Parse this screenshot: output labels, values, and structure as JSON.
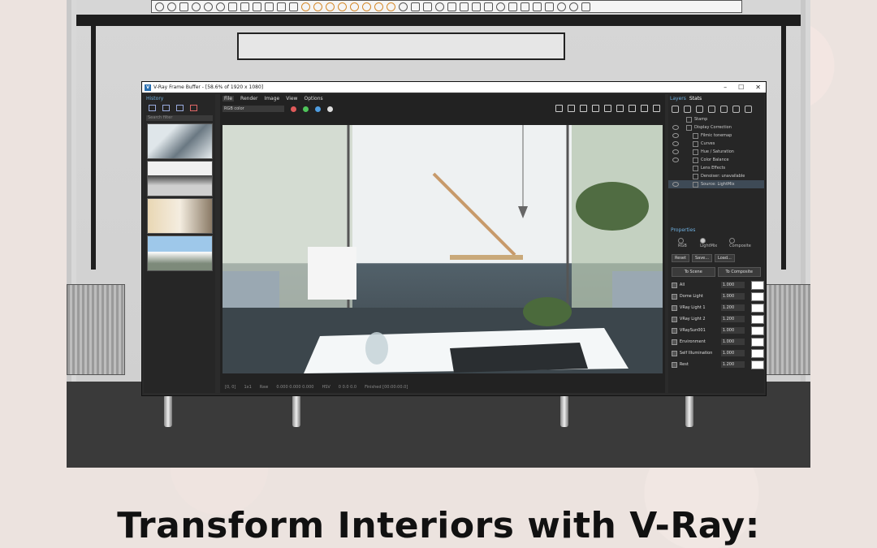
{
  "window": {
    "title": "V-Ray Frame Buffer - [58.6% of 1920 x 1080]",
    "logo": "V"
  },
  "history": {
    "title": "History",
    "search_placeholder": "Search filter",
    "thumbnails": [
      "render-thumb-1",
      "render-thumb-2",
      "render-thumb-3",
      "render-thumb-4"
    ]
  },
  "menu": [
    "File",
    "Render",
    "Image",
    "View",
    "Options"
  ],
  "channel": "RGB color",
  "layers": {
    "tabs": [
      "Layers",
      "Stats"
    ],
    "items": [
      "Stamp",
      "Display Correction",
      "Filmic tonemap",
      "Curves",
      "Hue / Saturation",
      "Color Balance",
      "Lens Effects",
      "Denoiser: unavailable",
      "Source: LightMix"
    ]
  },
  "properties": {
    "title": "Properties",
    "modes": [
      "RGB",
      "LightMix",
      "Composite"
    ],
    "buttons": {
      "reset": "Reset",
      "save": "Save...",
      "load": "Load...",
      "to_scene": "To Scene",
      "to_composite": "To Composite"
    },
    "rows": [
      {
        "name": "All",
        "value": "1.000"
      },
      {
        "name": "Dome Light",
        "value": "1.000"
      },
      {
        "name": "VRay Light 1",
        "value": "1.200"
      },
      {
        "name": "VRay Light 2",
        "value": "1.200"
      },
      {
        "name": "VRaySun001",
        "value": "1.000"
      },
      {
        "name": "Environment",
        "value": "1.000"
      },
      {
        "name": "Self Illumination",
        "value": "1.000"
      },
      {
        "name": "Rest",
        "value": "1.200"
      }
    ]
  },
  "status": {
    "coords": "[0, 0]",
    "zoom": "1x1",
    "mode": "Raw",
    "rgb": "0.000  0.000  0.000",
    "color_space": "HSV",
    "values": "0    0.0    0.0",
    "preview": "Finished [00:00:00.0]"
  },
  "headline": "Transform Interiors with V-Ray:",
  "colors": {
    "accent": "#6fb0e0",
    "panel": "#262626",
    "orange_icons": "#d58a2c"
  }
}
